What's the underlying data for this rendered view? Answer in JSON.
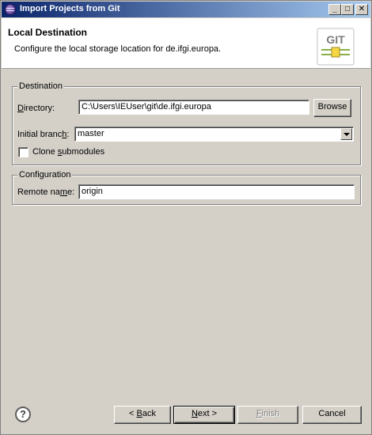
{
  "window": {
    "title": "Import Projects from Git",
    "minimize": "_",
    "maximize": "□",
    "close": "✕"
  },
  "header": {
    "title": "Local Destination",
    "description": "Configure the local storage location for de.ifgi.europa.",
    "logo_text": "GIT"
  },
  "destination": {
    "group_label": "Destination",
    "directory_label_mnemonic": "D",
    "directory_label_rest": "irectory:",
    "directory_value": "C:\\Users\\IEUser\\git\\de.ifgi.europa",
    "browse_label": "Browse",
    "branch_label_pre": "Initial branc",
    "branch_label_mnemonic": "h",
    "branch_label_post": ":",
    "branch_value": "master",
    "clone_label_pre": "Clone ",
    "clone_label_mnemonic": "s",
    "clone_label_post": "ubmodules",
    "clone_checked": false
  },
  "configuration": {
    "group_label": "Configuration",
    "remote_label_pre": "Remote na",
    "remote_label_mnemonic": "m",
    "remote_label_post": "e:",
    "remote_value": "origin"
  },
  "footer": {
    "help_symbol": "?",
    "back_pre": "< ",
    "back_mnemonic": "B",
    "back_post": "ack",
    "next_mnemonic": "N",
    "next_post": "ext >",
    "finish_mnemonic": "F",
    "finish_post": "inish",
    "cancel_label": "Cancel"
  }
}
